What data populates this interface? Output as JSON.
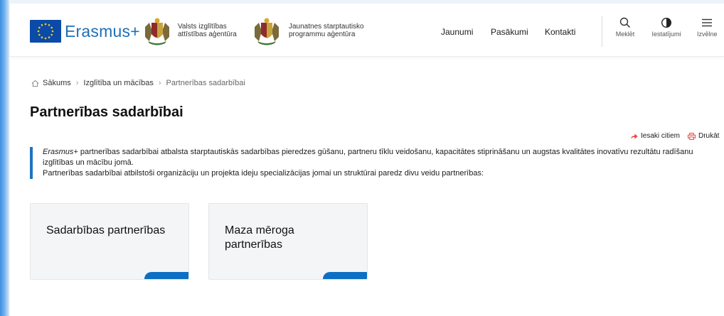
{
  "header": {
    "brand": "Erasmus+",
    "agency1": "Valsts izglītības attīstības aģentūra",
    "agency2": "Jaunatnes starptautisko programmu aģentūra",
    "nav": [
      "Jaunumi",
      "Pasākumi",
      "Kontakti"
    ],
    "tools": {
      "search": "Meklēt",
      "settings": "Iestatījumi",
      "menu": "Izvēlne"
    }
  },
  "breadcrumb": {
    "items": [
      "Sākums",
      "Izglītība un mācības",
      "Partnerības sadarbībai"
    ]
  },
  "page": {
    "title": "Partnerības sadarbībai",
    "share": "Iesaki citiem",
    "print": "Drukāt",
    "intro_em": "Erasmus+",
    "intro_rest": " partnerības sadarbībai atbalsta starptautiskās sadarbības pieredzes gūšanu, partneru tīklu veidošanu, kapacitātes stiprināšanu un augstas kvalitātes inovatīvu rezultātu radīšanu izglītības un mācību jomā.",
    "intro_line2": "Partnerības sadarbībai atbilstoši organizāciju un projekta ideju specializācijas jomai un struktūrai paredz divu veidu partnerības:"
  },
  "cards": [
    {
      "title": "Sadarbības partnerības"
    },
    {
      "title": "Maza mēroga partnerības"
    }
  ],
  "colors": {
    "accent": "#1e73be",
    "card_accent": "#0d6fc4",
    "share_icon": "#e8453c"
  }
}
